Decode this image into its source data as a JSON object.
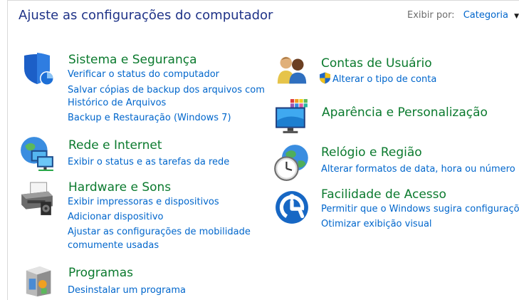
{
  "header": {
    "title": "Ajuste as configurações do computador",
    "view_by_label": "Exibir por:",
    "view_by_value": "Categoria"
  },
  "categories": {
    "system_security": {
      "title": "Sistema e Segurança",
      "links": [
        "Verificar o status do computador",
        "Salvar cópias de backup dos arquivos com",
        "Histórico de Arquivos",
        "Backup e Restauração (Windows 7)"
      ]
    },
    "network": {
      "title": "Rede e Internet",
      "links": [
        "Exibir o status e as tarefas da rede"
      ]
    },
    "hardware": {
      "title": "Hardware e Sons",
      "links": [
        "Exibir impressoras e dispositivos",
        "Adicionar dispositivo",
        "Ajustar as configurações de mobilidade",
        "comumente usadas"
      ]
    },
    "programs": {
      "title": "Programas",
      "links": [
        "Desinstalar um programa"
      ]
    },
    "user_accounts": {
      "title": "Contas de Usuário",
      "links": [
        "Alterar o tipo de conta"
      ]
    },
    "appearance": {
      "title": "Aparência e Personalização"
    },
    "clock_region": {
      "title": "Relógio e Região",
      "links": [
        "Alterar formatos de data, hora ou número"
      ]
    },
    "ease_access": {
      "title": "Facilidade de Acesso",
      "links": [
        "Permitir que o Windows sugira configurações",
        "Otimizar exibição visual"
      ]
    }
  },
  "icons": {
    "system_security": "shield-icon",
    "network": "globe-network-icon",
    "hardware": "printer-icon",
    "programs": "program-box-icon",
    "user_accounts": "users-icon",
    "uac": "uac-shield-icon",
    "appearance": "monitor-palette-icon",
    "clock_region": "globe-clock-icon",
    "ease_access": "ease-of-access-icon"
  },
  "colors": {
    "title": "#1e3287",
    "category_title": "#0b7a2e",
    "link": "#0066cc",
    "muted": "#6d6d6d"
  }
}
